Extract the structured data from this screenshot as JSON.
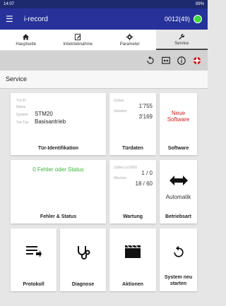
{
  "statusbar": {
    "time": "14:07",
    "battery": "89%"
  },
  "appbar": {
    "title": "i-record",
    "device_id": "0012(49)"
  },
  "tabs": [
    {
      "label": "Hauptseite",
      "icon": "home-icon"
    },
    {
      "label": "Inbetriebnahme",
      "icon": "edit-icon"
    },
    {
      "label": "Parameter",
      "icon": "gear-icon"
    },
    {
      "label": "Service",
      "icon": "wrench-icon",
      "active": true
    }
  ],
  "section": {
    "title": "Service"
  },
  "cards": {
    "tuer_id": {
      "caption": "Tür-Identifikation",
      "label_tuer_id": "Tür ID",
      "label_name": "Name",
      "label_system": "System",
      "value_system": "STM20",
      "label_tuer_typ": "Tür-Typ",
      "value_tuer_typ": "Basisantrieb"
    },
    "tuerdaten": {
      "caption": "Türdaten",
      "label_zyklen": "Zyklen",
      "value_zyklen": "1'755",
      "label_stunden": "Stunden",
      "value_stunden": "3'169"
    },
    "software": {
      "caption": "Software",
      "text_line1": "Neue",
      "text_line2": "Software"
    },
    "fehler": {
      "caption": "Fehler & Status",
      "text": "0 Fehler oder Status"
    },
    "wartung": {
      "caption": "Wartung",
      "label_zyklen": "Zyklen (x1000)",
      "value_zyklen": "1 / 0",
      "label_wochen": "Wochen",
      "value_wochen": "18 / 60"
    },
    "betriebsart": {
      "caption": "Betriebsart",
      "text": "Automatik"
    },
    "protokoll": {
      "caption": "Protokoll"
    },
    "diagnose": {
      "caption": "Diagnose"
    },
    "aktionen": {
      "caption": "Aktionen"
    },
    "system_neu": {
      "caption_line1": "System neu",
      "caption_line2": "starten"
    }
  },
  "colors": {
    "appbar": "#26329a",
    "accent_red": "#d0191b",
    "accent_green": "#37b737",
    "status_dot": "#3ddc3d"
  }
}
